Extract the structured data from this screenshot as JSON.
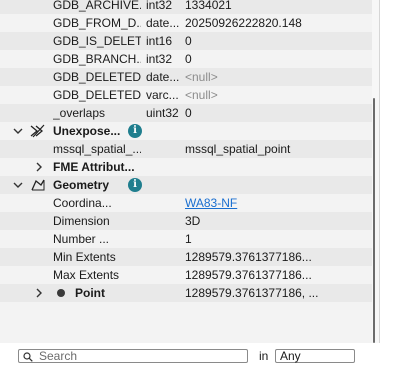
{
  "rows": [
    {
      "name": "GDB_ARCHIVE...",
      "type": "int32",
      "value": "1334021"
    },
    {
      "name": "GDB_FROM_D...",
      "type": "date...",
      "value": "20250926222820.148"
    },
    {
      "name": "GDB_IS_DELETE",
      "type": "int16",
      "value": "0"
    },
    {
      "name": "GDB_BRANCH...",
      "type": "int32",
      "value": "0"
    },
    {
      "name": "GDB_DELETED...",
      "type": "date...",
      "value": "<null>"
    },
    {
      "name": "GDB_DELETED...",
      "type": "varc...",
      "value": "<null>"
    },
    {
      "name": "_overlaps",
      "type": "uint32",
      "value": "0"
    }
  ],
  "unexposed": {
    "title": "Unexpose...",
    "info": "i",
    "row": {
      "name": "mssql_spatial_...",
      "value": "mssql_spatial_point"
    }
  },
  "fme_attrib": {
    "title": "FME Attribut..."
  },
  "geometry": {
    "title": "Geometry",
    "info": "i",
    "rows": [
      {
        "name": "Coordina...",
        "value": "WA83-NF"
      },
      {
        "name": "Dimension",
        "value": "3D"
      },
      {
        "name": "Number ...",
        "value": "1"
      },
      {
        "name": "Min Extents",
        "value": "1289579.3761377186..."
      },
      {
        "name": "Max Extents",
        "value": "1289579.3761377186..."
      }
    ],
    "point": {
      "name": "Point",
      "value": "1289579.3761377186, ..."
    }
  },
  "search": {
    "placeholder": "Search",
    "in_label": "in",
    "scope": "Any"
  },
  "colors": {
    "info_badge": "#1f7e8e",
    "link": "#1a6fd0",
    "alt_row": "#e9e9e9"
  }
}
